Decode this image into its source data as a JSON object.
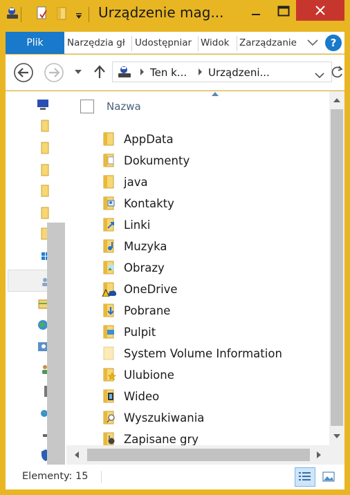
{
  "window": {
    "title": "Urządzenie mag..."
  },
  "ribbon": {
    "tabs": [
      {
        "label": "Plik"
      },
      {
        "label": "Narzędzia gł"
      },
      {
        "label": "Udostępniar"
      },
      {
        "label": "Widok"
      },
      {
        "label": "Zarządzanie"
      }
    ],
    "help_symbol": "?"
  },
  "address": {
    "crumbs": [
      {
        "label": "Ten k..."
      },
      {
        "label": "Urządzeni..."
      }
    ]
  },
  "file_list": {
    "column_header": "Nazwa",
    "items": [
      {
        "name": "AppData",
        "icon": "folder-icon"
      },
      {
        "name": "Dokumenty",
        "icon": "documents-folder-icon"
      },
      {
        "name": "java",
        "icon": "folder-icon"
      },
      {
        "name": "Kontakty",
        "icon": "contacts-folder-icon"
      },
      {
        "name": "Linki",
        "icon": "links-folder-icon"
      },
      {
        "name": "Muzyka",
        "icon": "music-folder-icon"
      },
      {
        "name": "Obrazy",
        "icon": "pictures-folder-icon"
      },
      {
        "name": "OneDrive",
        "icon": "onedrive-folder-icon"
      },
      {
        "name": "Pobrane",
        "icon": "downloads-folder-icon"
      },
      {
        "name": "Pulpit",
        "icon": "desktop-folder-icon"
      },
      {
        "name": "System Volume Information",
        "icon": "system-folder-icon"
      },
      {
        "name": "Ulubione",
        "icon": "favorites-folder-icon"
      },
      {
        "name": "Wideo",
        "icon": "videos-folder-icon"
      },
      {
        "name": "Wyszukiwania",
        "icon": "searches-folder-icon"
      },
      {
        "name": "Zapisane gry",
        "icon": "saved-games-folder-icon"
      }
    ]
  },
  "status": {
    "items_text": "Elementy: 15"
  },
  "colors": {
    "title_bar": "#e9b623",
    "file_tab": "#1979ca",
    "close_button": "#c7362c",
    "folder": "#f2c94c"
  }
}
